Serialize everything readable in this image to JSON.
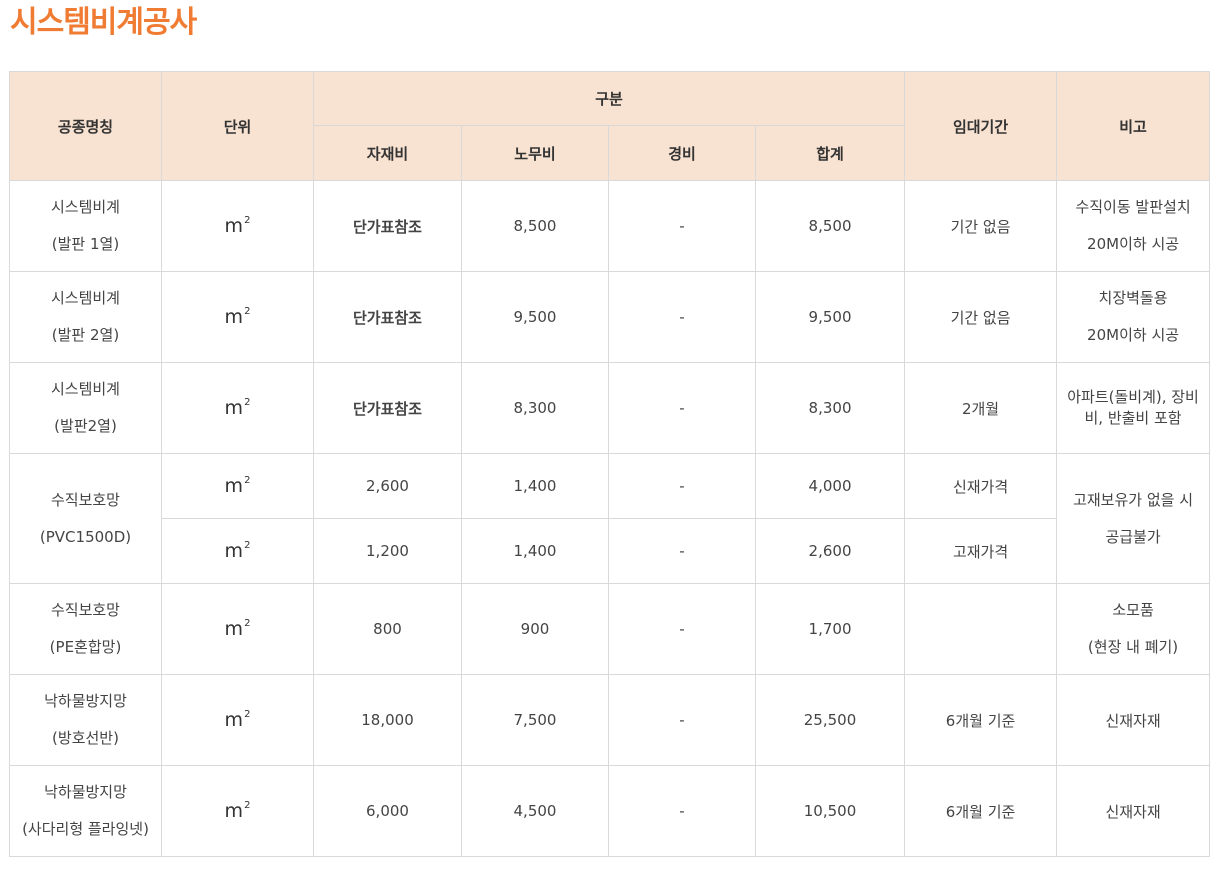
{
  "title": "시스템비계공사",
  "headers": {
    "name": "공종명칭",
    "unit": "단위",
    "group": "구분",
    "material": "자재비",
    "labor": "노무비",
    "expense": "경비",
    "total": "합계",
    "period": "임대기간",
    "note": "비고"
  },
  "unit_label": "m",
  "unit_sup": "2",
  "rows": [
    {
      "name1": "시스템비계",
      "name2": "(발판 1열)",
      "material": "단가표참조",
      "labor": "8,500",
      "expense": "-",
      "total": "8,500",
      "period": "기간 없음",
      "note1": "수직이동 발판설치",
      "note2": "20M이하 시공"
    },
    {
      "name1": "시스템비계",
      "name2": "(발판 2열)",
      "material": "단가표참조",
      "labor": "9,500",
      "expense": "-",
      "total": "9,500",
      "period": "기간 없음",
      "note1": "치장벽돌용",
      "note2": "20M이하 시공"
    },
    {
      "name1": "시스템비계",
      "name2": "(발판2열)",
      "material": "단가표참조",
      "labor": "8,300",
      "expense": "-",
      "total": "8,300",
      "period": "2개월",
      "note1": "아파트(돌비계), 장비비, 반출비 포함"
    },
    {
      "name1": "수직보호망",
      "name2": "(PVC1500D)",
      "material": "2,600",
      "labor": "1,400",
      "expense": "-",
      "total": "4,000",
      "period": "신재가격",
      "note1": "고재보유가 없을 시",
      "note2": "공급불가"
    },
    {
      "material": "1,200",
      "labor": "1,400",
      "expense": "-",
      "total": "2,600",
      "period": "고재가격"
    },
    {
      "name1": "수직보호망",
      "name2": "(PE혼합망)",
      "material": "800",
      "labor": "900",
      "expense": "-",
      "total": "1,700",
      "period": "",
      "note1": "소모품",
      "note2": "(현장 내 폐기)"
    },
    {
      "name1": "낙하물방지망",
      "name2": "(방호선반)",
      "material": "18,000",
      "labor": "7,500",
      "expense": "-",
      "total": "25,500",
      "period": "6개월 기준",
      "note1": "신재자재"
    },
    {
      "name1": "낙하물방지망",
      "name2": "(사다리형 플라잉넷)",
      "material": "6,000",
      "labor": "4,500",
      "expense": "-",
      "total": "10,500",
      "period": "6개월 기준",
      "note1": "신재자재"
    }
  ]
}
